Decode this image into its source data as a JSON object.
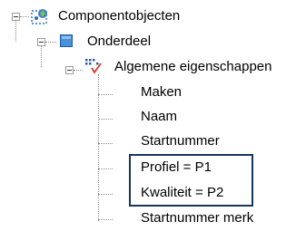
{
  "tree": {
    "root": {
      "label": "Componentobjecten",
      "icon": "component-objects-icon",
      "children": [
        {
          "label": "Onderdeel",
          "icon": "part-icon",
          "children": [
            {
              "label": "Algemene eigenschappen",
              "icon": "general-properties-icon",
              "properties": [
                "Maken",
                "Naam",
                "Startnummer",
                "Profiel = P1",
                "Kwaliteit = P2",
                "Startnummer merk"
              ]
            }
          ]
        }
      ]
    }
  },
  "colors": {
    "highlight_border": "#17365d",
    "part_icon_fill": "#4a8fd8",
    "dotted_guides": "#8a8a8a",
    "property_icon_red": "#d63a2a",
    "property_icon_blue": "#2f5aa8"
  }
}
